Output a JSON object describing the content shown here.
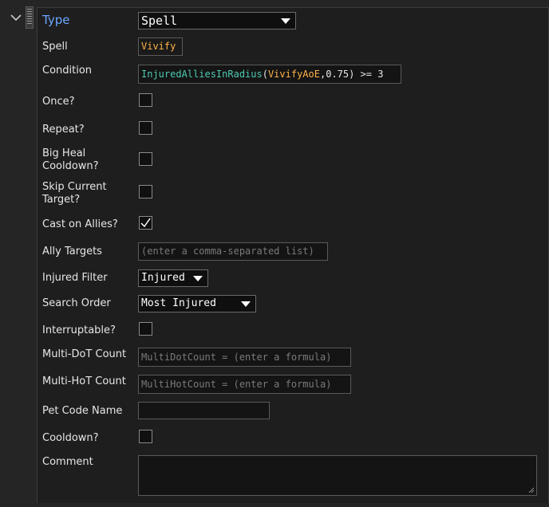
{
  "rows": {
    "type": {
      "label": "Type",
      "value": "Spell"
    },
    "spell": {
      "label": "Spell",
      "value": "Vivify"
    },
    "condition": {
      "label": "Condition",
      "fn": "InjuredAlliesInRadius",
      "paren_open": "(",
      "arg": "VivifyAoE",
      "comma": ",",
      "num": "0.75",
      "rest": ") >= 3"
    },
    "once": {
      "label": "Once?",
      "checked": false
    },
    "repeat": {
      "label": "Repeat?",
      "checked": false
    },
    "big_heal": {
      "label": "Big Heal\nCooldown?",
      "checked": false
    },
    "skip_target": {
      "label": "Skip Current\nTarget?",
      "checked": false
    },
    "cast_allies": {
      "label": "Cast on Allies?",
      "checked": true
    },
    "ally_targets": {
      "label": "Ally Targets",
      "placeholder": "(enter a comma-separated list)"
    },
    "injured_filter": {
      "label": "Injured Filter",
      "value": "Injured"
    },
    "search_order": {
      "label": "Search Order",
      "value": "Most Injured"
    },
    "interruptable": {
      "label": "Interruptable?",
      "checked": false
    },
    "multi_dot": {
      "label": "Multi-DoT Count",
      "placeholder": "MultiDotCount  =  (enter a formula)"
    },
    "multi_hot": {
      "label": "Multi-HoT Count",
      "placeholder": "MultiHotCount  =  (enter a formula)"
    },
    "pet_code": {
      "label": "Pet Code Name",
      "value": ""
    },
    "cooldown": {
      "label": "Cooldown?",
      "checked": false
    },
    "comment": {
      "label": "Comment",
      "value": ""
    }
  },
  "colors": {
    "background": "#1e1e1e",
    "type_label": "#6aa7ff",
    "spell_text": "#ffb347",
    "function_text": "#4ec9b0",
    "check_mark": "#ffffff"
  },
  "icons": {
    "collapse": "chevron-down-icon",
    "drag": "grip-icon",
    "dropdown": "caret-down-icon",
    "check": "check-icon",
    "resize": "resize-grip-icon"
  }
}
